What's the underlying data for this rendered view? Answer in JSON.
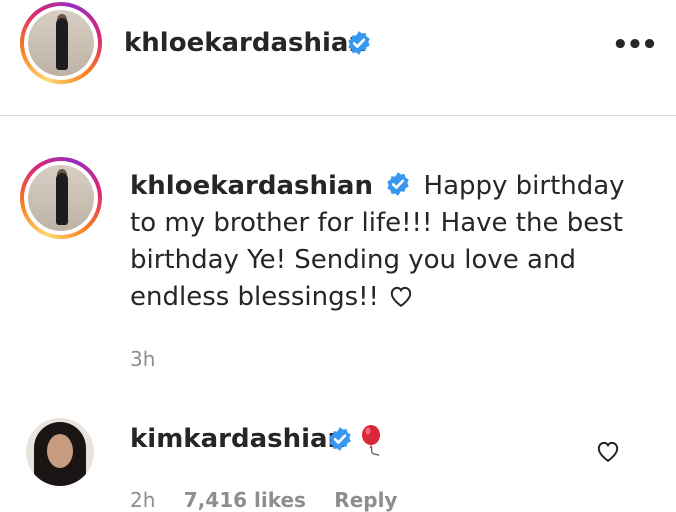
{
  "post_header": {
    "username": "khloekardashian",
    "more_icon": "more-horizontal-icon"
  },
  "caption": {
    "username": "khloekardashian",
    "text": "Happy birthday to my brother for life!!! Have the best birthday Ye! Sending you love and endless blessings!!",
    "emoji_icon": "heart-outline-icon",
    "time": "3h"
  },
  "comment": {
    "username": "kimkardashian",
    "emoji_icon": "balloon-icon",
    "time": "2h",
    "likes": "7,416 likes",
    "reply": "Reply",
    "like_icon": "heart-outline-icon"
  },
  "colors": {
    "verified": "#3897f0",
    "secondary_text": "#8e8e8e",
    "divider": "#dbdbdb"
  }
}
